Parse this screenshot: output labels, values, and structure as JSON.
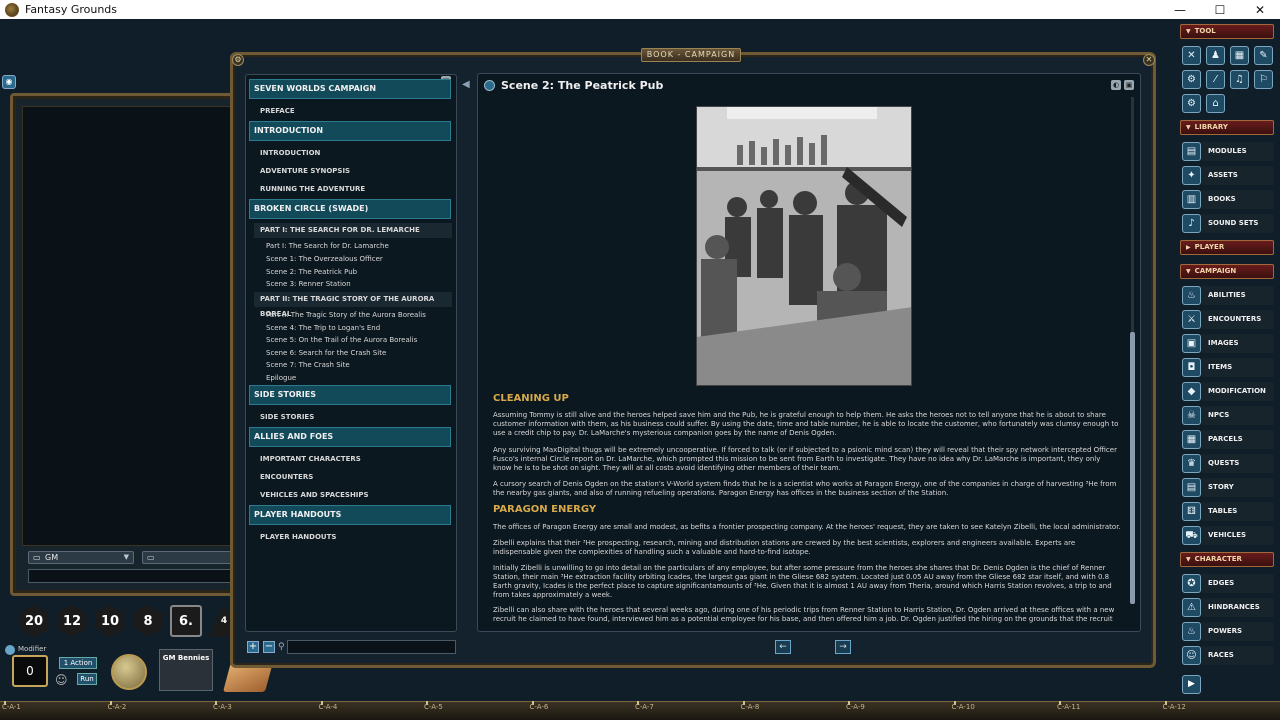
{
  "window": {
    "title": "Fantasy Grounds",
    "minimize": "—",
    "maximize": "☐",
    "close": "✕"
  },
  "chat": {
    "identity": "GM",
    "identity_icon": "▭",
    "second_icon": "▭"
  },
  "dice": [
    "20",
    "12",
    "10",
    "8",
    "6.",
    "4"
  ],
  "modifier": {
    "label": "Modifier",
    "value": "0"
  },
  "actions": {
    "action_label": "1 Action",
    "run_label": "Run"
  },
  "bennies": {
    "label": "GM Bennies"
  },
  "bottom_bar": {
    "labels": [
      "C-A-1",
      "C-A-2",
      "C-A-3",
      "C-A-4",
      "C-A-5",
      "C-A-6",
      "C-A-7",
      "C-A-8",
      "C-A-9",
      "C-A-10",
      "C-A-11",
      "C-A-12"
    ]
  },
  "book": {
    "title": "BOOK - CAMPAIGN",
    "toc": {
      "header": "SEVEN WORLDS CAMPAIGN",
      "preface": "PREFACE",
      "sections": [
        {
          "title": "INTRODUCTION",
          "items": [
            "INTRODUCTION",
            "ADVENTURE SYNOPSIS",
            "RUNNING THE ADVENTURE"
          ]
        },
        {
          "title": "BROKEN CIRCLE (SWADE)",
          "part1": "PART I: THE SEARCH FOR DR. LEMARCHE",
          "part1_items": [
            "Part I:  The Search for Dr. Lamarche",
            "Scene 1:  The Overzealous Officer",
            "Scene 2:  The Peatrick Pub",
            "Scene 3:  Renner Station"
          ],
          "part2": "PART II: THE TRAGIC STORY OF THE AURORA BOREAL",
          "part2_items": [
            "Part II:  The Tragic Story of the Aurora Borealis",
            "Scene 4:  The Trip to Logan's End",
            "Scene 5:  On the Trail of the Aurora Borealis",
            "Scene 6:  Search for the Crash Site",
            "Scene 7:  The Crash Site",
            "Epilogue"
          ]
        },
        {
          "title": "SIDE STORIES",
          "items": [
            "SIDE STORIES"
          ]
        },
        {
          "title": "ALLIES AND FOES",
          "items": [
            "IMPORTANT CHARACTERS",
            "ENCOUNTERS",
            "VEHICLES AND SPACESHIPS"
          ]
        },
        {
          "title": "PLAYER HANDOUTS",
          "items": [
            "PLAYER HANDOUTS"
          ]
        }
      ]
    },
    "content": {
      "scene_title": "Scene 2:  The Peatrick Pub",
      "heading1": "CLEANING UP",
      "p1": "Assuming Tommy is still alive and the heroes helped save him and the Pub, he is grateful enough to help them. He asks the heroes not to tell anyone that he is about to share customer information with them, as his business could suffer. By using the date, time and table number, he is able to locate the customer, who fortunately was clumsy enough to use a credit chip to pay. Dr. LaMarche's mysterious companion goes by the name of Denis Ogden.",
      "p2": "Any surviving MaxDigital thugs will be extremely uncooperative. If forced to talk (or if subjected to a psionic mind scan) they will reveal that their spy network intercepted Officer Fusco's internal Circle report on Dr. LaMarche, which prompted this mission to be sent from Earth to investigate. They have no idea why Dr. LaMarche is important, they only know he is to be shot on sight. They will at all costs avoid identifying other members of their team.",
      "p3": "A cursory search of Denis Ogden on the station's V-World system finds that he is a scientist who works at Paragon Energy, one of the companies in charge of harvesting ³He from the nearby gas giants, and also of running refueling operations. Paragon Energy has offices in the business section of the Station.",
      "heading2": "PARAGON ENERGY",
      "p4": "The offices of Paragon Energy are small and modest, as befits a frontier prospecting company. At the heroes' request, they are taken to see Katelyn Zibelli, the local administrator.",
      "p5": "Zibelli explains that their ³He prospecting, research, mining and distribution stations are crewed by the best scientists, explorers and engineers available. Experts are indispensable given the complexities of handling such a valuable and hard-to-find isotope.",
      "p6": "Initially Zibelli is unwilling to go into detail on the particulars of any employee, but after some pressure from the heroes she shares that Dr. Denis Ogden is the chief of Renner Station, their main ³He extraction facility orbiting Icades, the largest gas giant in the Gliese 682 system. Located just 0.05 AU away from the Gliese 682 star itself, and with 0.8 Earth gravity, Icades is the perfect place to capture significantamounts of ³He. Given that it is almost 1 AU away from Theria, around which Harris Station revolves, a trip to and from takes approximately a week.",
      "p7": "Zibelli can also share with the heroes that several weeks ago, during one of his periodic trips from Renner Station to Harris Station, Dr. Ogden arrived at these offices with a new recruit he claimed to have found, interviewed him as a potential employee for his base, and then offered him a job. Dr. Ogden justified the hiring on the grounds that the recruit"
    },
    "nav_prev": "←",
    "nav_next": "→"
  },
  "sidebar": {
    "tool": {
      "label": "TOOL",
      "icons": [
        "✕",
        "♟",
        "▦",
        "✎",
        "⚙",
        "⁄",
        "♫",
        "⚐",
        "⚙",
        "⌂"
      ]
    },
    "library": {
      "label": "LIBRARY",
      "items": [
        "MODULES",
        "ASSETS",
        "BOOKS",
        "SOUND SETS"
      ]
    },
    "player": {
      "label": "PLAYER"
    },
    "campaign": {
      "label": "CAMPAIGN",
      "items": [
        "ABILITIES",
        "ENCOUNTERS",
        "IMAGES",
        "ITEMS",
        "MODIFICATION",
        "NPCS",
        "PARCELS",
        "QUESTS",
        "STORY",
        "TABLES",
        "VEHICLES"
      ]
    },
    "character": {
      "label": "CHARACTER",
      "items": [
        "EDGES",
        "HINDRANCES",
        "POWERS",
        "RACES"
      ]
    }
  },
  "colors": {
    "accent_heading": "#d7a94a",
    "toc_header": "#124a5a",
    "sidebar_section": "#6a1c1c",
    "frame_gold": "#6e5a34"
  }
}
